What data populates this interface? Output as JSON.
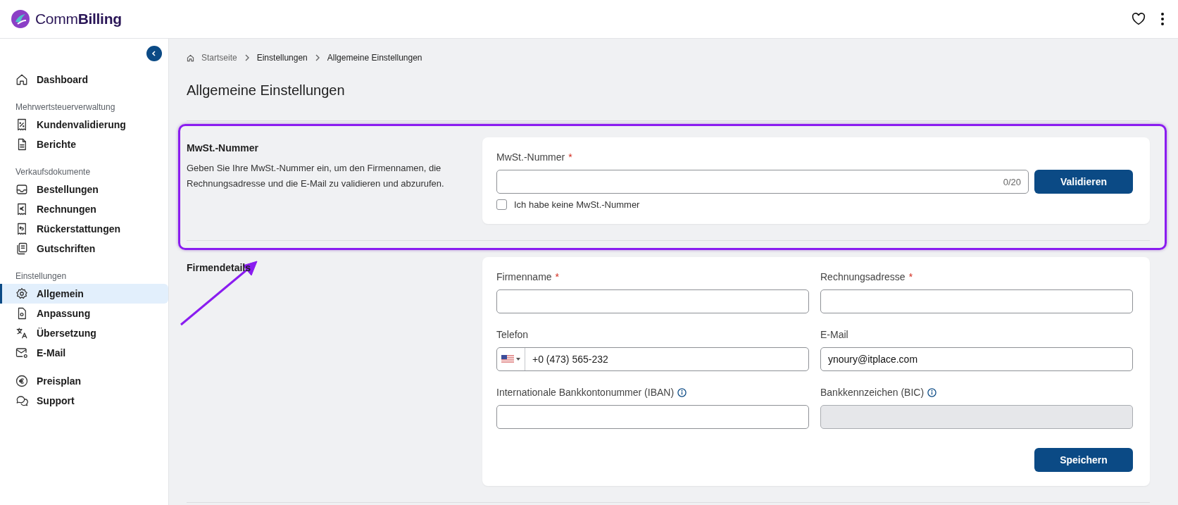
{
  "header": {
    "logo_text_light": "Comm",
    "logo_text_bold": "Billing"
  },
  "sidebar": {
    "groups": [
      {
        "items": [
          {
            "label": "Dashboard",
            "selected": false
          }
        ]
      },
      {
        "heading": "Mehrwertsteuerverwaltung",
        "items": [
          {
            "label": "Kundenvalidierung",
            "selected": false
          },
          {
            "label": "Berichte",
            "selected": false
          }
        ]
      },
      {
        "heading": "Verkaufsdokumente",
        "items": [
          {
            "label": "Bestellungen",
            "selected": false
          },
          {
            "label": "Rechnungen",
            "selected": false
          },
          {
            "label": "Rückerstattungen",
            "selected": false
          },
          {
            "label": "Gutschriften",
            "selected": false
          }
        ]
      },
      {
        "heading": "Einstellungen",
        "items": [
          {
            "label": "Allgemein",
            "selected": true
          },
          {
            "label": "Anpassung",
            "selected": false
          },
          {
            "label": "Übersetzung",
            "selected": false
          },
          {
            "label": "E-Mail",
            "selected": false
          }
        ]
      },
      {
        "items": [
          {
            "label": "Preisplan",
            "selected": false
          },
          {
            "label": "Support",
            "selected": false
          }
        ]
      }
    ]
  },
  "breadcrumb": [
    "Startseite",
    "Einstellungen",
    "Allgemeine Einstellungen"
  ],
  "page_title": "Allgemeine Einstellungen",
  "vat_section": {
    "title": "MwSt.-Nummer",
    "description": "Geben Sie Ihre MwSt.-Nummer ein, um den Firmennamen, die Rechnungsadresse und die E-Mail zu validieren und abzurufen.",
    "field_label": "MwSt.-Nummer",
    "required_mark": "*",
    "counter": "0/20",
    "button": "Validieren",
    "checkbox": {
      "label": "Ich habe keine MwSt.-Nummer",
      "checked": false
    }
  },
  "company_section": {
    "title": "Firmendetails",
    "fields": [
      {
        "kind": "text",
        "label": "Firmenname",
        "required_mark": "*"
      },
      {
        "kind": "text",
        "label": "Rechnungsadresse",
        "required_mark": "*"
      },
      {
        "kind": "phone",
        "label": "Telefon",
        "value": "+0 (473) 565-232"
      },
      {
        "kind": "text",
        "label": "E-Mail",
        "value": "ynoury@itplace.com"
      },
      {
        "kind": "text",
        "label": "Internationale Bankkontonummer (IBAN)",
        "info": true
      },
      {
        "kind": "text",
        "label": "Bankkennzeichen (BIC)",
        "info": true,
        "disabled": true
      }
    ],
    "button": "Speichern"
  }
}
